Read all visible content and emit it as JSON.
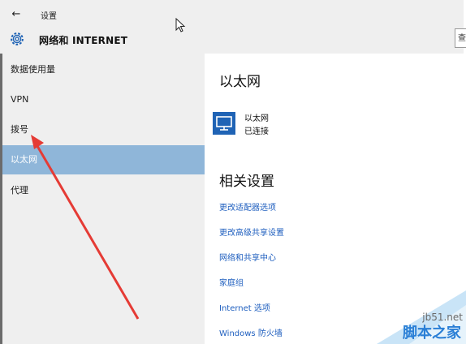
{
  "window": {
    "back_glyph": "←",
    "app_title": "设置"
  },
  "header": {
    "page_title": "网络和 INTERNET",
    "search_fragment": "查"
  },
  "sidebar": {
    "items": [
      {
        "label": "数据使用量",
        "active": false
      },
      {
        "label": "VPN",
        "active": false
      },
      {
        "label": "拨号",
        "active": false
      },
      {
        "label": "以太网",
        "active": true
      },
      {
        "label": "代理",
        "active": false
      }
    ]
  },
  "main": {
    "section_title": "以太网",
    "connection": {
      "name": "以太网",
      "status": "已连接",
      "icon": "monitor-network-icon"
    },
    "related_title": "相关设置",
    "links": [
      "更改适配器选项",
      "更改高级共享设置",
      "网络和共享中心",
      "家庭组",
      "Internet 选项",
      "Windows 防火墙"
    ]
  },
  "watermark": {
    "site": "jb51.net",
    "brand": "脚本之家"
  },
  "colors": {
    "accent": "#1f63b5",
    "selected": "#8fb6d9",
    "link": "#1f5fbf",
    "arrow": "#e53b35"
  }
}
